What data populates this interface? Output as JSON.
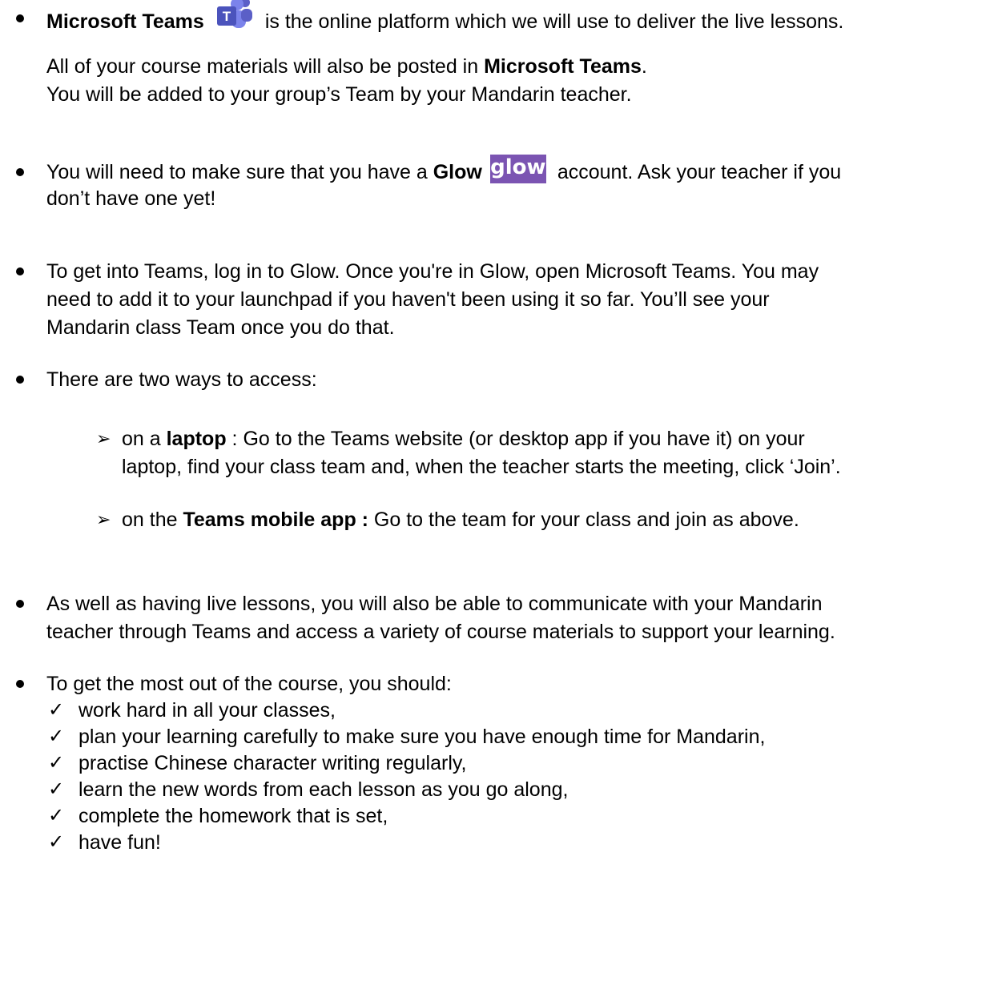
{
  "bullets": {
    "teams": {
      "bold": "Microsoft Teams",
      "logo_icon": "microsoft-teams-logo-icon",
      "text": "is the online platform which we will use to deliver the live lessons.",
      "line2_pre": "All of your course materials will also be posted in ",
      "line2_bold": "Microsoft Teams",
      "line2_post": ".",
      "line3": "You will be added to your group’s Team by your Mandarin teacher."
    },
    "glow": {
      "pre": "You will need to make sure that you have a ",
      "bold": "Glow",
      "logo_text": "glow",
      "post": "account. Ask your teacher if you",
      "line2": "don’t have one yet!"
    },
    "login": {
      "line1": "To get into Teams, log in to Glow. Once you're in Glow, open Microsoft Teams. You may",
      "line2": "need to add it to your launchpad if you haven't been using it so far. You’ll see your",
      "line3": "Mandarin class Team once you do that."
    },
    "access": {
      "intro": "There are two ways to access:",
      "laptop_pre": "on a ",
      "laptop_bold": "laptop",
      "laptop_post": " : Go to the Teams website (or desktop app if you have it) on your",
      "laptop_line2": "laptop, find your class team and, when the teacher starts the meeting, click ‘Join’.",
      "mobile_pre": "on the ",
      "mobile_bold": "Teams mobile app :",
      "mobile_post": " Go to the team for your class and join as above."
    },
    "communicate": {
      "line1": "As well as having live lessons, you will also be able to communicate with your Mandarin",
      "line2": "teacher through Teams and access a variety of course materials to support your learning."
    },
    "most": {
      "intro": "To get the most out of the course, you should:",
      "checklist": [
        "work hard in all your classes,",
        "plan your learning carefully to make sure you have enough time for Mandarin,",
        "practise Chinese character writing regularly,",
        "learn the new words from each lesson as you go along,",
        "complete the homework that is set,",
        "have fun!"
      ]
    }
  },
  "colors": {
    "teams_purple": "#5b5fc7",
    "glow_purple": "#7b54b2"
  }
}
